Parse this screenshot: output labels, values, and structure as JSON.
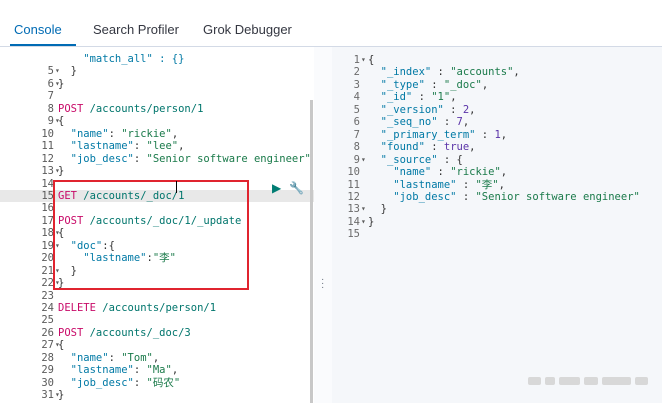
{
  "tabs": [
    "Console",
    "Search Profiler",
    "Grok Debugger"
  ],
  "left_editor": {
    "lines": [
      {
        "n": "",
        "fold": "",
        "parts": [
          [
            "k-key",
            "    \"match_all\" : {}"
          ]
        ]
      },
      {
        "n": "5",
        "fold": "▾",
        "parts": [
          [
            "k-punc",
            "  }"
          ]
        ]
      },
      {
        "n": "6",
        "fold": "▾",
        "parts": [
          [
            "k-punc",
            "}"
          ]
        ]
      },
      {
        "n": "7",
        "fold": "",
        "parts": []
      },
      {
        "n": "8",
        "fold": "",
        "parts": [
          [
            "k-method",
            "POST "
          ],
          [
            "k-url",
            "/accounts/person/1"
          ]
        ]
      },
      {
        "n": "9",
        "fold": "▾",
        "parts": [
          [
            "k-punc",
            "{"
          ]
        ]
      },
      {
        "n": "10",
        "fold": "",
        "parts": [
          [
            "k-key",
            "  \"name\""
          ],
          [
            "k-punc",
            ": "
          ],
          [
            "k-str",
            "\"rickie\""
          ],
          [
            "k-punc",
            ","
          ]
        ]
      },
      {
        "n": "11",
        "fold": "",
        "parts": [
          [
            "k-key",
            "  \"lastname\""
          ],
          [
            "k-punc",
            ": "
          ],
          [
            "k-str",
            "\"lee\""
          ],
          [
            "k-punc",
            ","
          ]
        ]
      },
      {
        "n": "12",
        "fold": "",
        "parts": [
          [
            "k-key",
            "  \"job_desc\""
          ],
          [
            "k-punc",
            ": "
          ],
          [
            "k-str",
            "\"Senior software engineer\""
          ]
        ]
      },
      {
        "n": "13",
        "fold": "▾",
        "parts": [
          [
            "k-punc",
            "}"
          ]
        ]
      },
      {
        "n": "14",
        "fold": "",
        "parts": []
      },
      {
        "n": "15",
        "fold": "",
        "parts": [
          [
            "k-method",
            "GET "
          ],
          [
            "k-url",
            "/accounts/_doc/1"
          ]
        ]
      },
      {
        "n": "16",
        "fold": "",
        "parts": []
      },
      {
        "n": "17",
        "fold": "",
        "parts": [
          [
            "k-method",
            "POST "
          ],
          [
            "k-url",
            "/accounts/_doc/1/_update"
          ]
        ]
      },
      {
        "n": "18",
        "fold": "▾",
        "parts": [
          [
            "k-punc",
            "{"
          ]
        ]
      },
      {
        "n": "19",
        "fold": "▾",
        "parts": [
          [
            "k-key",
            "  \"doc\""
          ],
          [
            "k-punc",
            ":{"
          ]
        ]
      },
      {
        "n": "20",
        "fold": "",
        "parts": [
          [
            "k-key",
            "    \"lastname\""
          ],
          [
            "k-punc",
            ":"
          ],
          [
            "k-str",
            "\"李\""
          ]
        ]
      },
      {
        "n": "21",
        "fold": "▾",
        "parts": [
          [
            "k-punc",
            "  }"
          ]
        ]
      },
      {
        "n": "22",
        "fold": "▾",
        "parts": [
          [
            "k-punc",
            "}"
          ]
        ]
      },
      {
        "n": "23",
        "fold": "",
        "parts": []
      },
      {
        "n": "24",
        "fold": "",
        "parts": [
          [
            "k-method",
            "DELETE "
          ],
          [
            "k-url",
            "/accounts/person/1"
          ]
        ]
      },
      {
        "n": "25",
        "fold": "",
        "parts": []
      },
      {
        "n": "26",
        "fold": "",
        "parts": [
          [
            "k-method",
            "POST "
          ],
          [
            "k-url",
            "/accounts/_doc/3"
          ]
        ]
      },
      {
        "n": "27",
        "fold": "▾",
        "parts": [
          [
            "k-punc",
            "{"
          ]
        ]
      },
      {
        "n": "28",
        "fold": "",
        "parts": [
          [
            "k-key",
            "  \"name\""
          ],
          [
            "k-punc",
            ": "
          ],
          [
            "k-str",
            "\"Tom\""
          ],
          [
            "k-punc",
            ","
          ]
        ]
      },
      {
        "n": "29",
        "fold": "",
        "parts": [
          [
            "k-key",
            "  \"lastname\""
          ],
          [
            "k-punc",
            ": "
          ],
          [
            "k-str",
            "\"Ma\""
          ],
          [
            "k-punc",
            ","
          ]
        ]
      },
      {
        "n": "30",
        "fold": "",
        "parts": [
          [
            "k-key",
            "  \"job_desc\""
          ],
          [
            "k-punc",
            ": "
          ],
          [
            "k-str",
            "\"码农\""
          ]
        ]
      },
      {
        "n": "31",
        "fold": "▾",
        "parts": [
          [
            "k-punc",
            "}"
          ]
        ]
      },
      {
        "n": "32",
        "fold": "",
        "parts": []
      }
    ]
  },
  "right_editor": {
    "lines": [
      {
        "n": "1",
        "fold": "▾",
        "parts": [
          [
            "k-punc",
            "{"
          ]
        ]
      },
      {
        "n": "2",
        "fold": "",
        "parts": [
          [
            "k-key",
            "  \"_index\""
          ],
          [
            "k-punc",
            " : "
          ],
          [
            "k-str",
            "\"accounts\""
          ],
          [
            "k-punc",
            ","
          ]
        ]
      },
      {
        "n": "3",
        "fold": "",
        "parts": [
          [
            "k-key",
            "  \"_type\""
          ],
          [
            "k-punc",
            " : "
          ],
          [
            "k-str",
            "\"_doc\""
          ],
          [
            "k-punc",
            ","
          ]
        ]
      },
      {
        "n": "4",
        "fold": "",
        "parts": [
          [
            "k-key",
            "  \"_id\""
          ],
          [
            "k-punc",
            " : "
          ],
          [
            "k-str",
            "\"1\""
          ],
          [
            "k-punc",
            ","
          ]
        ]
      },
      {
        "n": "5",
        "fold": "",
        "parts": [
          [
            "k-key",
            "  \"_version\""
          ],
          [
            "k-punc",
            " : "
          ],
          [
            "k-lit",
            "2"
          ],
          [
            "k-punc",
            ","
          ]
        ]
      },
      {
        "n": "6",
        "fold": "",
        "parts": [
          [
            "k-key",
            "  \"_seq_no\""
          ],
          [
            "k-punc",
            " : "
          ],
          [
            "k-lit",
            "7"
          ],
          [
            "k-punc",
            ","
          ]
        ]
      },
      {
        "n": "7",
        "fold": "",
        "parts": [
          [
            "k-key",
            "  \"_primary_term\""
          ],
          [
            "k-punc",
            " : "
          ],
          [
            "k-lit",
            "1"
          ],
          [
            "k-punc",
            ","
          ]
        ]
      },
      {
        "n": "8",
        "fold": "",
        "parts": [
          [
            "k-key",
            "  \"found\""
          ],
          [
            "k-punc",
            " : "
          ],
          [
            "k-lit",
            "true"
          ],
          [
            "k-punc",
            ","
          ]
        ]
      },
      {
        "n": "9",
        "fold": "▾",
        "parts": [
          [
            "k-key",
            "  \"_source\""
          ],
          [
            "k-punc",
            " : {"
          ]
        ]
      },
      {
        "n": "10",
        "fold": "",
        "parts": [
          [
            "k-key",
            "    \"name\""
          ],
          [
            "k-punc",
            " : "
          ],
          [
            "k-str",
            "\"rickie\""
          ],
          [
            "k-punc",
            ","
          ]
        ]
      },
      {
        "n": "11",
        "fold": "",
        "parts": [
          [
            "k-key",
            "    \"lastname\""
          ],
          [
            "k-punc",
            " : "
          ],
          [
            "k-str",
            "\"李\""
          ],
          [
            "k-punc",
            ","
          ]
        ]
      },
      {
        "n": "12",
        "fold": "",
        "parts": [
          [
            "k-key",
            "    \"job_desc\""
          ],
          [
            "k-punc",
            " : "
          ],
          [
            "k-str",
            "\"Senior software engineer\""
          ]
        ]
      },
      {
        "n": "13",
        "fold": "▾",
        "parts": [
          [
            "k-punc",
            "  }"
          ]
        ]
      },
      {
        "n": "14",
        "fold": "▾",
        "parts": [
          [
            "k-punc",
            "}"
          ]
        ]
      },
      {
        "n": "15",
        "fold": "",
        "parts": []
      }
    ]
  },
  "icons": {
    "run": "play-icon",
    "settings": "wrench-icon",
    "resize": "drag-handle-icon"
  },
  "colors": {
    "accent": "#006bb4",
    "run": "#017d73",
    "highlight_box": "#e0242f"
  }
}
